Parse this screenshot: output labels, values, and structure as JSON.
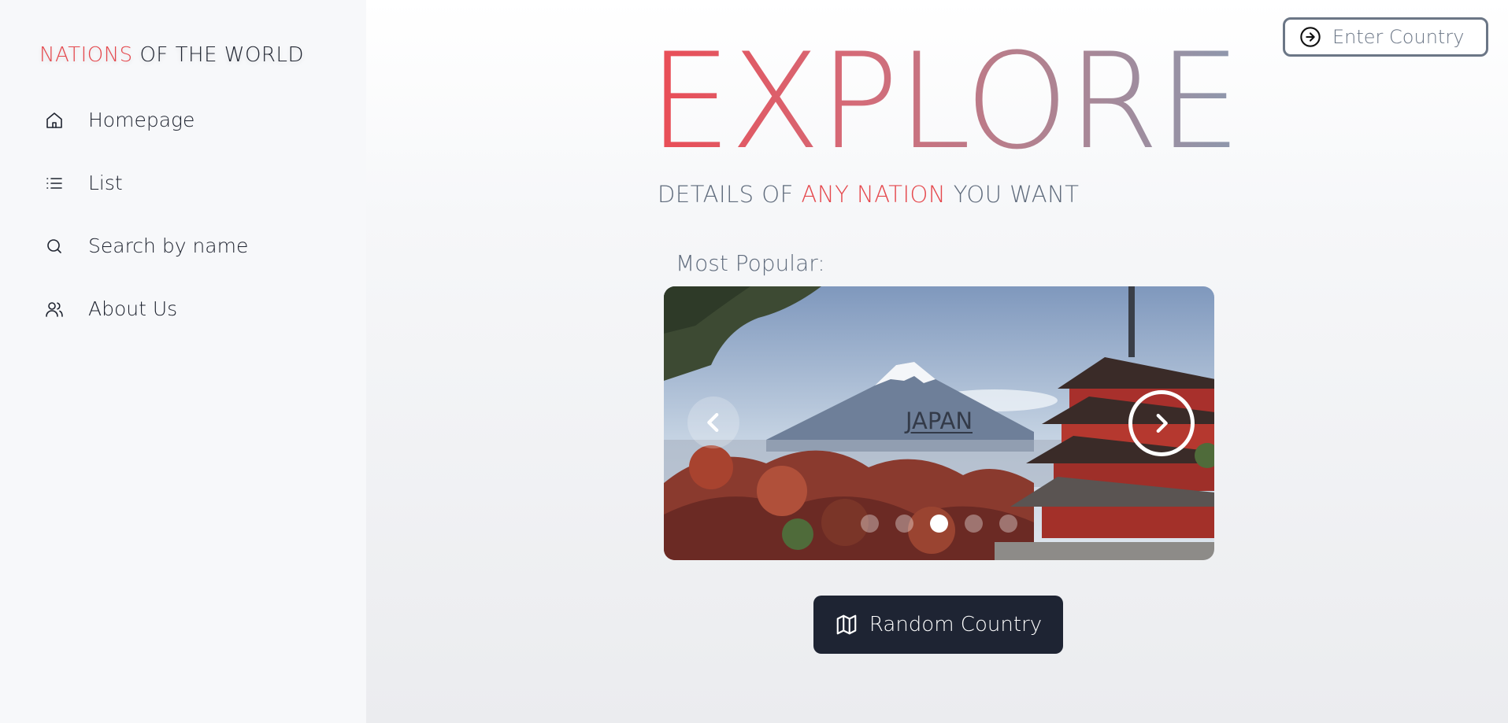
{
  "brand": {
    "accent": "NATIONS",
    "rest": " OF THE WORLD"
  },
  "nav": [
    {
      "icon": "home-icon",
      "label": "Homepage"
    },
    {
      "icon": "list-icon",
      "label": "List"
    },
    {
      "icon": "search-icon",
      "label": "Search by name"
    },
    {
      "icon": "users-icon",
      "label": "About Us"
    }
  ],
  "search": {
    "placeholder": "Enter Country",
    "icon": "arrow-right-circle-icon"
  },
  "hero": {
    "title": "EXPLORE",
    "subtitle_pre": "DETAILS OF ",
    "subtitle_accent": "ANY NATION",
    "subtitle_post": " YOU WANT"
  },
  "popular": {
    "label": "Most Popular:",
    "current_slide": "JAPAN",
    "slide_count": 5,
    "active_index": 2
  },
  "random_button": {
    "label": "Random Country",
    "icon": "map-icon"
  },
  "colors": {
    "accent": "#e5484d",
    "dark_button": "#1e2433",
    "muted_text": "#5f6b7c"
  }
}
